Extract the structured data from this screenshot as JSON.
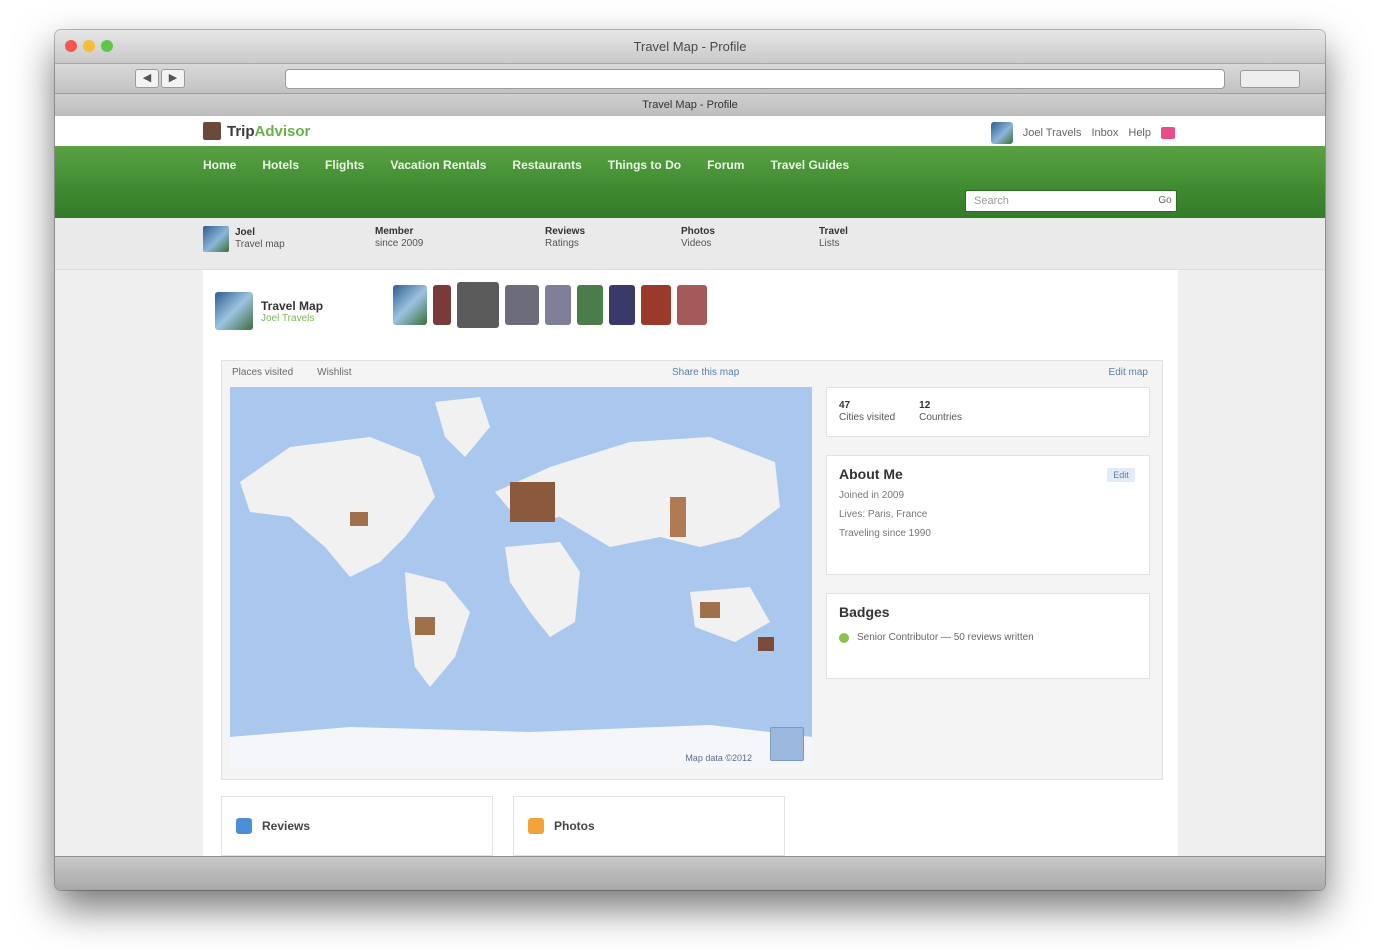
{
  "window": {
    "title": "Travel Map - Profile"
  },
  "browser": {
    "address": "",
    "tab_title": "Travel Map - Profile"
  },
  "site": {
    "logo": {
      "name": "Trip",
      "accent": "Advisor"
    },
    "user": {
      "name": "Joel Travels",
      "links": [
        "Inbox",
        "Help"
      ]
    },
    "nav": [
      "Home",
      "Hotels",
      "Flights",
      "Vacation Rentals",
      "Restaurants",
      "Things to Do",
      "Forum",
      "Travel Guides"
    ],
    "search": {
      "placeholder": "Search",
      "button": "Go"
    }
  },
  "subnav": [
    {
      "title": "Joel",
      "sub": "Travel map"
    },
    {
      "title": "Member",
      "sub": "since 2009"
    },
    {
      "title": "Reviews",
      "sub": "Ratings"
    },
    {
      "title": "Photos",
      "sub": "Videos"
    },
    {
      "title": "Travel",
      "sub": "Lists"
    }
  ],
  "profile": {
    "name": "Travel Map",
    "sub": "Joel Travels"
  },
  "map_panel": {
    "tabs": [
      "Places visited",
      "Wishlist"
    ],
    "link": "Share this map",
    "edit": "Edit map",
    "credit": "Map data ©2012"
  },
  "stats": [
    {
      "value": "47",
      "label": "Cities visited"
    },
    {
      "value": "12",
      "label": "Countries"
    }
  ],
  "about": {
    "title": "About Me",
    "edit": "Edit",
    "lines": [
      "Joined in 2009",
      "Lives: Paris, France",
      "Traveling since 1990"
    ]
  },
  "badges": {
    "title": "Badges",
    "item": "Senior Contributor — 50 reviews written"
  },
  "cards": [
    {
      "label": "Reviews",
      "color": "#4a90d9"
    },
    {
      "label": "Photos",
      "color": "#f2a33a"
    }
  ],
  "colors": {
    "nav_green": "#4a9539",
    "map_water": "#aac8ee",
    "land": "#f1f1f1",
    "pin": "#8b5a3c"
  }
}
